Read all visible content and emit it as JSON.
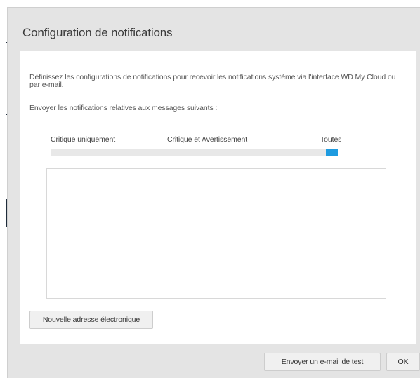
{
  "dialog": {
    "title": "Configuration de notifications",
    "description": "Définissez les configurations de notifications pour recevoir les notifications système via l'interface WD My Cloud ou par e-mail.",
    "subtitle": "Envoyer les notifications relatives aux messages suivants :",
    "notification_level": {
      "options": [
        "Critique uniquement",
        "Critique et Avertissement",
        "Toutes"
      ],
      "selected": "Toutes",
      "accent_color": "#1e9be0"
    },
    "email_list": [],
    "new_email_button": "Nouvelle adresse électronique",
    "test_email_button": "Envoyer un e-mail de test",
    "ok_button": "OK"
  }
}
